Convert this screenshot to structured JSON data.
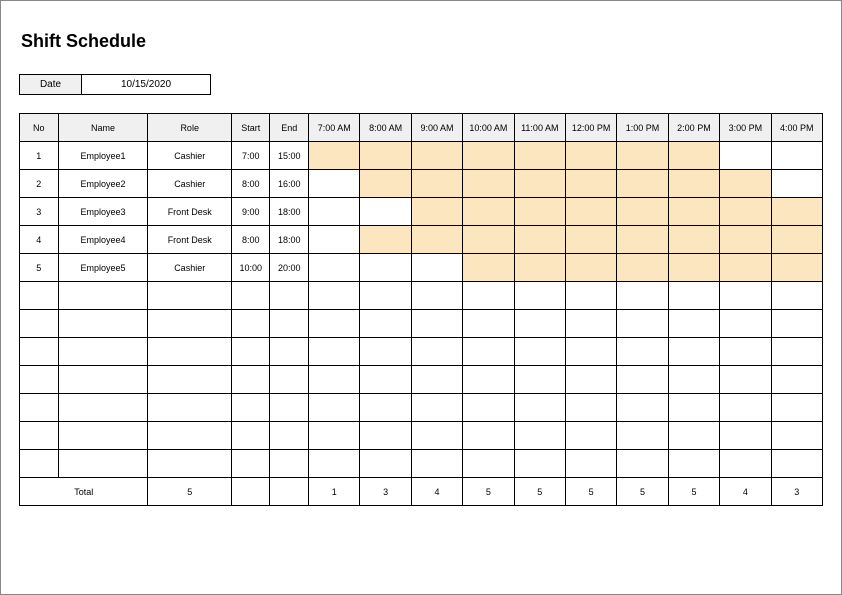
{
  "title": "Shift Schedule",
  "date": {
    "label": "Date",
    "value": "10/15/2020"
  },
  "headers": {
    "no": "No",
    "name": "Name",
    "role": "Role",
    "start": "Start",
    "end": "End",
    "hours": [
      "7:00 AM",
      "8:00 AM",
      "9:00 AM",
      "10:00 AM",
      "11:00 AM",
      "12:00 PM",
      "1:00 PM",
      "2:00 PM",
      "3:00 PM",
      "4:00 PM"
    ]
  },
  "rows": [
    {
      "no": "1",
      "name": "Employee1",
      "role": "Cashier",
      "start": "7:00",
      "end": "15:00",
      "shift": [
        true,
        true,
        true,
        true,
        true,
        true,
        true,
        true,
        false,
        false
      ]
    },
    {
      "no": "2",
      "name": "Employee2",
      "role": "Cashier",
      "start": "8:00",
      "end": "16:00",
      "shift": [
        false,
        true,
        true,
        true,
        true,
        true,
        true,
        true,
        true,
        false
      ]
    },
    {
      "no": "3",
      "name": "Employee3",
      "role": "Front Desk",
      "start": "9:00",
      "end": "18:00",
      "shift": [
        false,
        false,
        true,
        true,
        true,
        true,
        true,
        true,
        true,
        true
      ]
    },
    {
      "no": "4",
      "name": "Employee4",
      "role": "Front Desk",
      "start": "8:00",
      "end": "18:00",
      "shift": [
        false,
        true,
        true,
        true,
        true,
        true,
        true,
        true,
        true,
        true
      ]
    },
    {
      "no": "5",
      "name": "Employee5",
      "role": "Cashier",
      "start": "10:00",
      "end": "20:00",
      "shift": [
        false,
        false,
        false,
        true,
        true,
        true,
        true,
        true,
        true,
        true
      ]
    }
  ],
  "emptyRows": 7,
  "total": {
    "label": "Total",
    "roleCount": "5",
    "counts": [
      "1",
      "3",
      "4",
      "5",
      "5",
      "5",
      "5",
      "5",
      "4",
      "3"
    ]
  }
}
